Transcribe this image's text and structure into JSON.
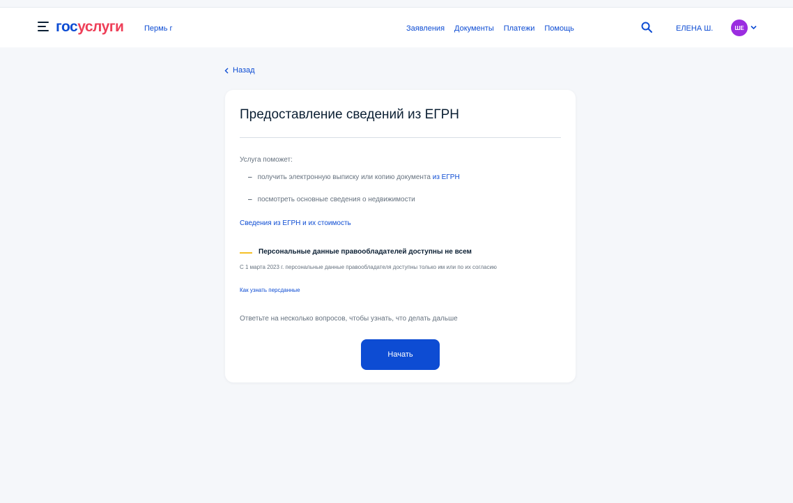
{
  "header": {
    "logo_part1": "гос",
    "logo_part2": "услуги",
    "region": "Пермь г",
    "nav": [
      "Заявления",
      "Документы",
      "Платежи",
      "Помощь"
    ],
    "user_name": "ЕЛЕНА Ш.",
    "avatar_initials": "ШЕ"
  },
  "back_label": "Назад",
  "card": {
    "title": "Предоставление сведений из ЕГРН",
    "intro": "Услуга поможет:",
    "bullet1_text": "получить электронную выписку или копию документа",
    "bullet1_link": "из ЕГРН",
    "bullet2_text": "посмотреть основные сведения о недвижимости",
    "info_link": "Сведения из ЕГРН и их стоимость",
    "notice_title": "Персональные данные правообладателей доступны не всем",
    "notice_text": "С 1 марта 2023 г. персональные данные правообладателя доступны только им или по их согласию",
    "notice_link": "Как узнать персданные",
    "answer_text": "Ответьте на несколько вопросов, чтобы узнать, что делать дальше",
    "start_button": "Начать"
  },
  "colors": {
    "brand_blue": "#0d4cd3",
    "brand_red": "#ee3f58",
    "avatar": "#9b2de0",
    "notice_accent": "#f5c026"
  }
}
